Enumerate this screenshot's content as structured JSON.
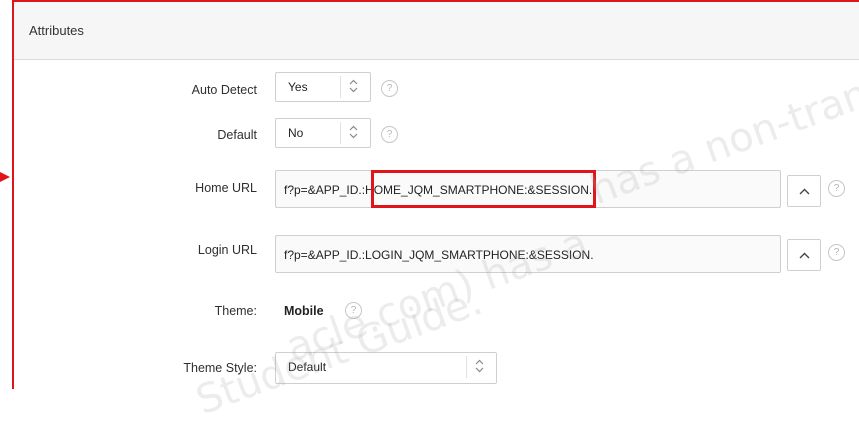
{
  "panel": {
    "title": "Attributes"
  },
  "fields": {
    "auto_detect": {
      "label": "Auto Detect",
      "value": "Yes"
    },
    "default": {
      "label": "Default",
      "value": "No"
    },
    "home_url": {
      "label": "Home URL",
      "value": "f?p=&APP_ID.:HOME_JQM_SMARTPHONE:&SESSION."
    },
    "login_url": {
      "label": "Login URL",
      "value": "f?p=&APP_ID.:LOGIN_JQM_SMARTPHONE:&SESSION."
    },
    "theme": {
      "label": "Theme:",
      "value": "Mobile"
    },
    "theme_style": {
      "label": "Theme Style:",
      "value": "Default"
    }
  },
  "help_glyph": "?",
  "watermark": {
    "line1": "has a non-trans",
    "line2": "acle.com) has a",
    "line3": "Student Guide."
  },
  "colors": {
    "highlight": "#e0141b",
    "header_bg": "#f6f6f6"
  },
  "icons": {
    "spinner": "chevron-up-down-icon",
    "lov": "chevron-up-icon",
    "help": "help-icon"
  }
}
